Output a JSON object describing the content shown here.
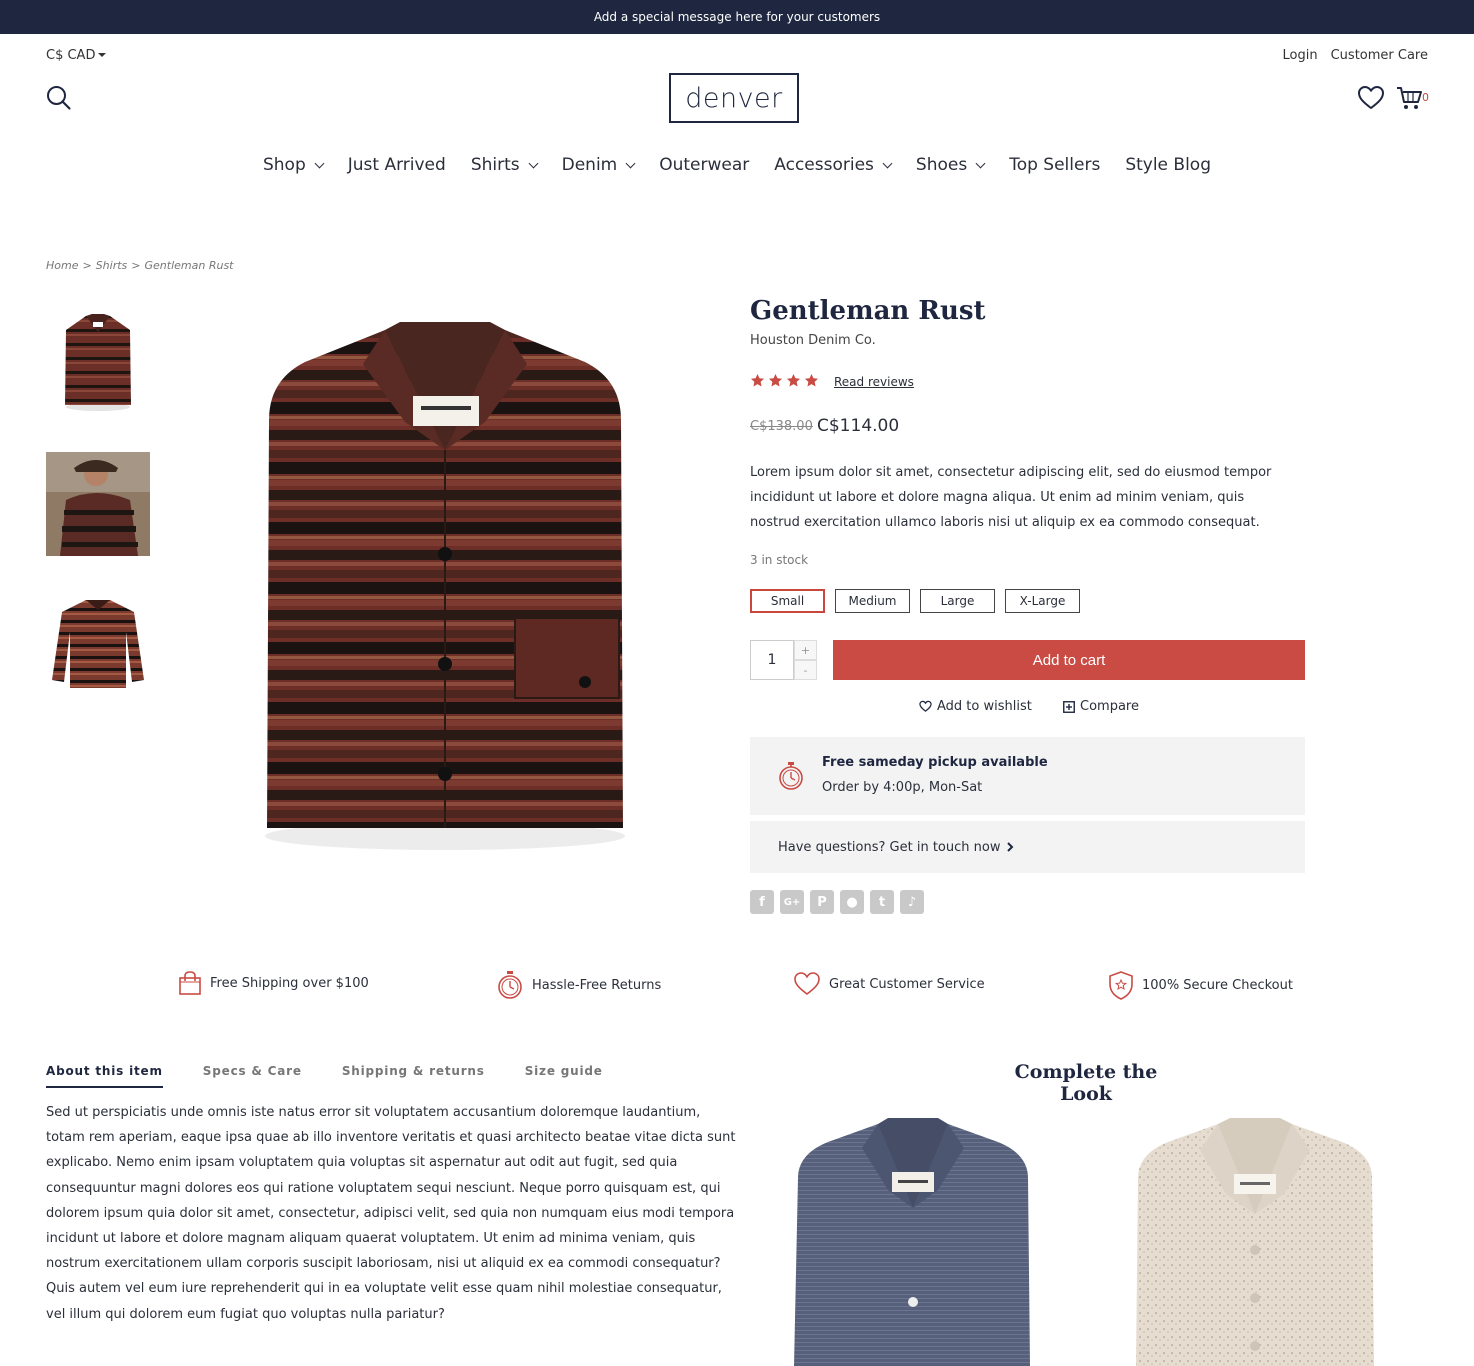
{
  "announcement": "Add a special message here for your customers",
  "header": {
    "currency": "C$ CAD",
    "login": "Login",
    "customer_care": "Customer Care",
    "logo": "denver",
    "cart_count": "0"
  },
  "nav": [
    {
      "label": "Shop",
      "dropdown": true
    },
    {
      "label": "Just Arrived",
      "dropdown": false
    },
    {
      "label": "Shirts",
      "dropdown": true
    },
    {
      "label": "Denim",
      "dropdown": true
    },
    {
      "label": "Outerwear",
      "dropdown": false
    },
    {
      "label": "Accessories",
      "dropdown": true
    },
    {
      "label": "Shoes",
      "dropdown": true
    },
    {
      "label": "Top Sellers",
      "dropdown": false
    },
    {
      "label": "Style Blog",
      "dropdown": false
    }
  ],
  "breadcrumb": [
    "Home",
    ">",
    "Shirts",
    ">",
    "Gentleman Rust"
  ],
  "product": {
    "title": "Gentleman Rust",
    "brand": "Houston Denim Co.",
    "rating": 4,
    "read_reviews": "Read reviews",
    "price_old": "C$138.00",
    "price_new": "C$114.00",
    "description": "Lorem ipsum dolor sit amet, consectetur adipiscing elit, sed do eiusmod tempor incididunt ut labore et dolore magna aliqua. Ut enim ad minim veniam, quis nostrud exercitation ullamco laboris nisi ut aliquip ex ea commodo consequat.",
    "stock": "3 in stock",
    "sizes": [
      "Small",
      "Medium",
      "Large",
      "X-Large"
    ],
    "selected_size": "Small",
    "quantity": "1",
    "qty_plus": "+",
    "qty_minus": "-",
    "add_to_cart": "Add to cart",
    "add_to_wishlist": "Add to wishlist",
    "compare": "Compare"
  },
  "pickup": {
    "title": "Free sameday pickup available",
    "subtitle": "Order by 4:00p, Mon-Sat"
  },
  "questions": "Have questions? Get in touch now",
  "share_icons": [
    "facebook-icon",
    "google-plus-icon",
    "pinterest-icon",
    "reddit-icon",
    "tumblr-icon",
    "twitter-icon"
  ],
  "features": [
    {
      "icon": "shopping-bag-icon",
      "label": "Free Shipping over $100"
    },
    {
      "icon": "stopwatch-icon",
      "label": "Hassle-Free Returns"
    },
    {
      "icon": "heart-icon",
      "label": "Great Customer Service"
    },
    {
      "icon": "shield-star-icon",
      "label": "100% Secure Checkout"
    }
  ],
  "tabs": [
    "About this item",
    "Specs & Care",
    "Shipping & returns",
    "Size guide"
  ],
  "active_tab": "About this item",
  "tab_body": "Sed ut perspiciatis unde omnis iste natus error sit voluptatem accusantium doloremque laudantium, totam rem aperiam, eaque ipsa quae ab illo inventore veritatis et quasi architecto beatae vitae dicta sunt explicabo. Nemo enim ipsam voluptatem quia voluptas sit aspernatur aut odit aut fugit, sed quia consequuntur magni dolores eos qui ratione voluptatem sequi nesciunt. Neque porro quisquam est, qui dolorem ipsum quia dolor sit amet, consectetur, adipisci velit, sed quia non numquam eius modi tempora incidunt ut labore et dolore magnam aliquam quaerat voluptatem. Ut enim ad minima veniam, quis nostrum exercitationem ullam corporis suscipit laboriosam, nisi ut aliquid ex ea commodi consequatur? Quis autem vel eum iure reprehenderit qui in ea voluptate velit esse quam nihil molestiae consequatur, vel illum qui dolorem eum fugiat quo voluptas nulla pariatur?",
  "complete_the_look": "Complete the Look",
  "colors": {
    "navy": "#1f2740",
    "accent_red": "#c94b44",
    "panel_grey": "#f3f3f4"
  }
}
